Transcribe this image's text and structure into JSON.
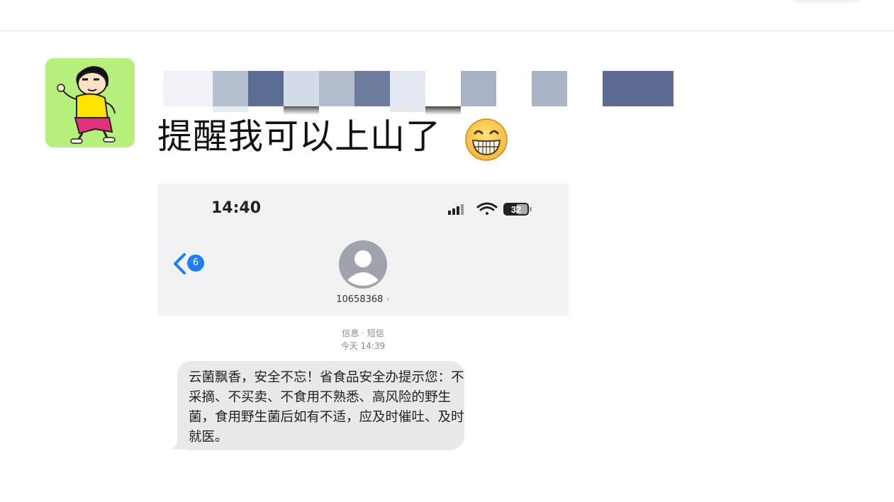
{
  "post": {
    "text": "提醒我可以上山了"
  },
  "screenshot": {
    "status_time": "14:40",
    "battery": "32",
    "back_badge": "6",
    "contact_number": "10658368",
    "chevron": "›",
    "meta_line1": "信息 · 短信",
    "meta_line2": "今天 14:39",
    "message": "云菌飘香，安全不忘！省食品安全办提示您：不采摘、不买卖、不食用不熟悉、高风险的野生菌，食用野生菌后如有不适，应及时催吐、及时就医。"
  },
  "colors": {
    "avatar_bg": "#b7ef7c",
    "ios_blue": "#1f7ff0",
    "bubble": "#e9e9eb"
  },
  "icons": [
    "grinning-emoji-icon",
    "signal-icon",
    "wifi-icon",
    "battery-icon",
    "back-chevron-icon",
    "contact-avatar-icon"
  ]
}
